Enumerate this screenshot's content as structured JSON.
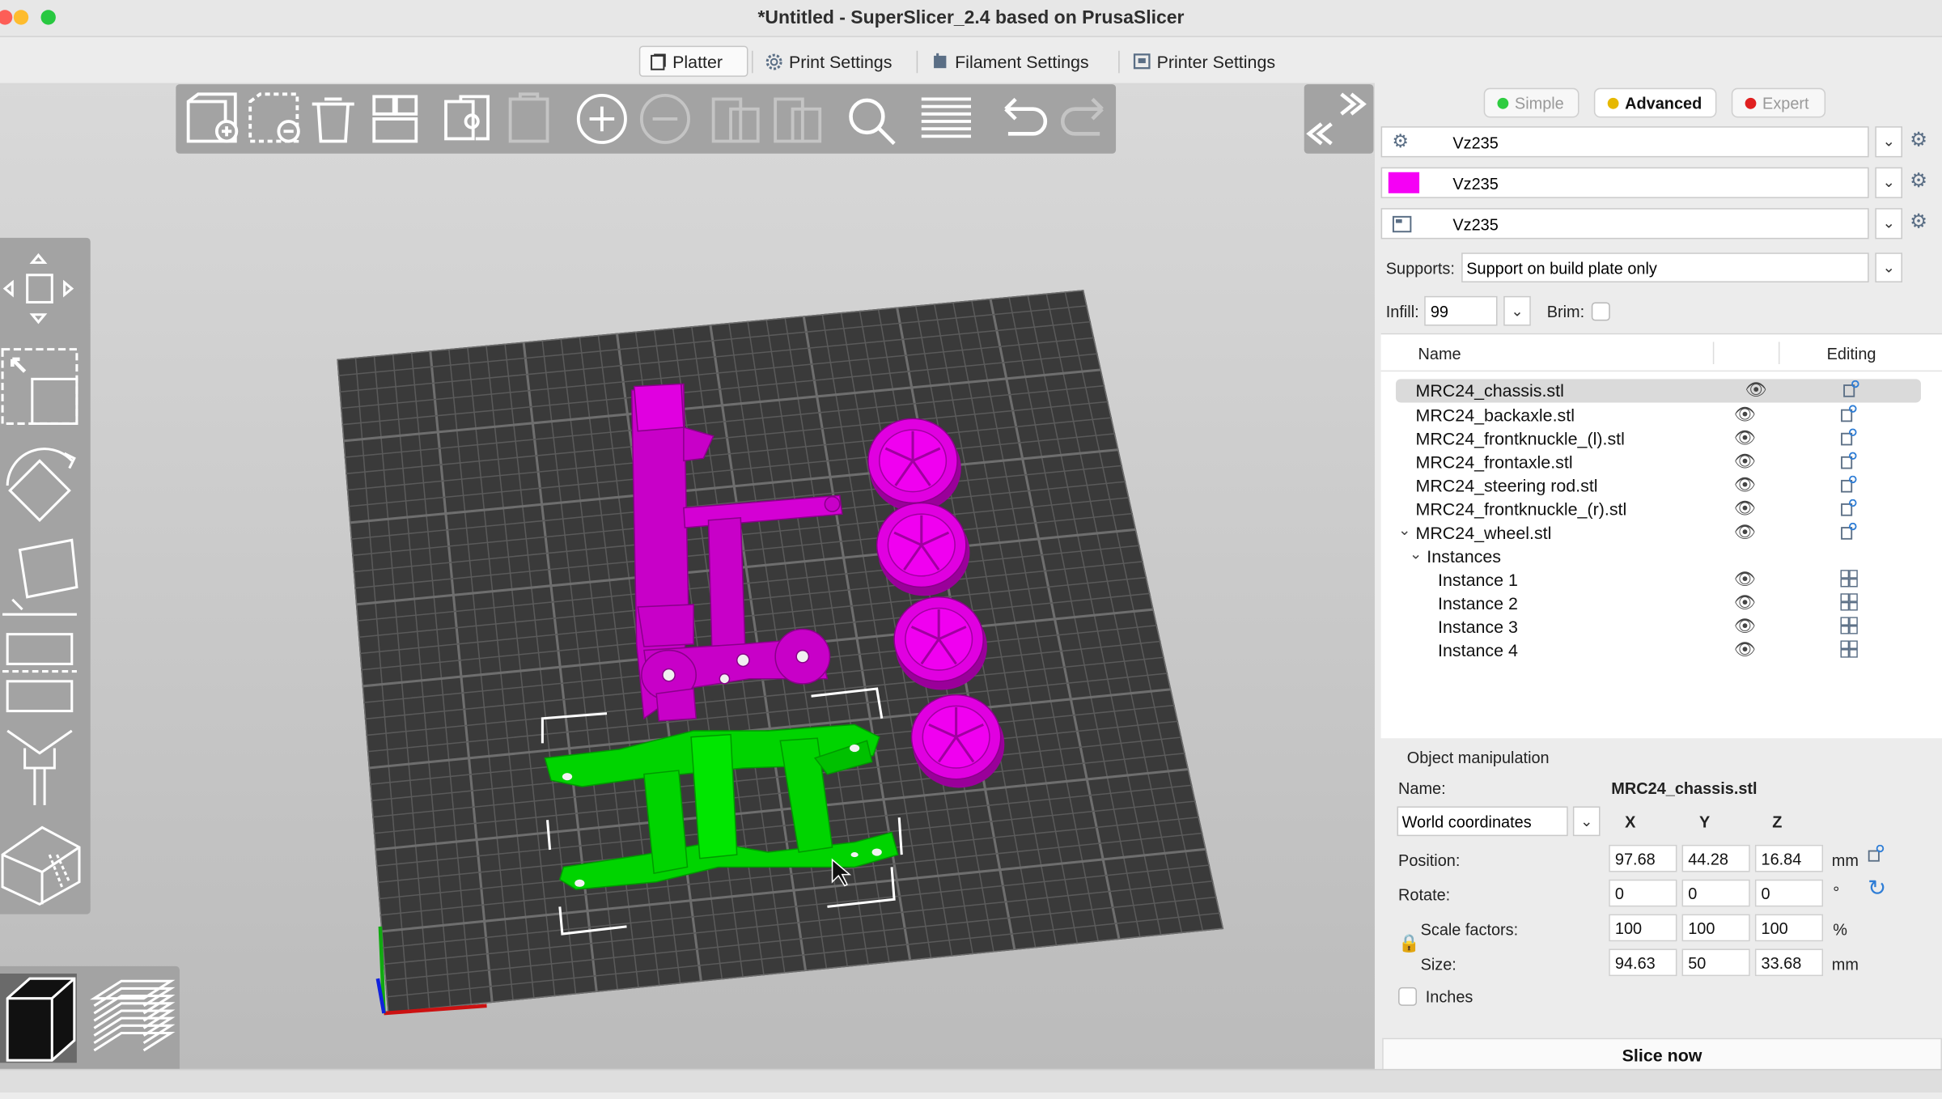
{
  "window": {
    "title": "*Untitled - SuperSlicer_2.4  based on PrusaSlicer"
  },
  "tabs": [
    {
      "label": "Platter"
    },
    {
      "label": "Print Settings"
    },
    {
      "label": "Filament Settings"
    },
    {
      "label": "Printer Settings"
    }
  ],
  "toolbar": {
    "icons": [
      "add-icon",
      "delete-icon",
      "delete-all-icon",
      "arrange-icon",
      "copy-icon",
      "paste-icon",
      "add-instance-icon",
      "remove-instance-icon",
      "split-objects-icon",
      "split-parts-icon",
      "search-icon",
      "layer-editing-icon",
      "undo-icon",
      "redo-icon"
    ]
  },
  "modes": {
    "simple": "Simple",
    "advanced": "Advanced",
    "expert": "Expert"
  },
  "colors": {
    "simple": "#2ecc40",
    "advanced": "#e6b800",
    "expert": "#e02020",
    "filament": "#f500f5",
    "object_magenta": "#c800c8",
    "object_green": "#00d400"
  },
  "presets": {
    "print": "Vz235",
    "filament": "Vz235",
    "printer": "Vz235"
  },
  "supports": {
    "label": "Supports:",
    "value": "Support on build plate only"
  },
  "infill": {
    "label": "Infill:",
    "value": "99"
  },
  "brim": {
    "label": "Brim:"
  },
  "object_list": {
    "col_name": "Name",
    "col_editing": "Editing",
    "objects": [
      {
        "name": "MRC24_chassis.stl"
      },
      {
        "name": "MRC24_backaxle.stl"
      },
      {
        "name": "MRC24_frontknuckle_(l).stl"
      },
      {
        "name": "MRC24_frontaxle.stl"
      },
      {
        "name": "MRC24_steering rod.stl"
      },
      {
        "name": "MRC24_frontknuckle_(r).stl"
      },
      {
        "name": "MRC24_wheel.stl"
      }
    ],
    "instances_label": "Instances",
    "instances": [
      "Instance 1",
      "Instance 2",
      "Instance 3",
      "Instance 4"
    ]
  },
  "object_manipulation": {
    "title": "Object manipulation",
    "name_label": "Name:",
    "name_value": "MRC24_chassis.stl",
    "coords": "World coordinates",
    "axes": {
      "x": "X",
      "y": "Y",
      "z": "Z"
    },
    "position": {
      "label": "Position:",
      "x": "97.68",
      "y": "44.28",
      "z": "16.84",
      "unit": "mm"
    },
    "rotate": {
      "label": "Rotate:",
      "x": "0",
      "y": "0",
      "z": "0",
      "unit": "°"
    },
    "scale": {
      "label": "Scale factors:",
      "x": "100",
      "y": "100",
      "z": "100",
      "unit": "%"
    },
    "size": {
      "label": "Size:",
      "x": "94.63",
      "y": "50",
      "z": "33.68",
      "unit": "mm"
    },
    "inches_label": "Inches"
  },
  "slice_button": "Slice now"
}
